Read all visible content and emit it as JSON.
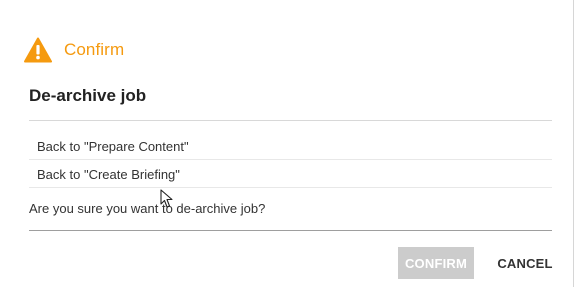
{
  "dialog": {
    "header_title": "Confirm",
    "header_icon": "warning-icon",
    "accent_color": "#f59a0f",
    "job_title": "De-archive job",
    "options": [
      {
        "label": "Back to \"Prepare Content\""
      },
      {
        "label": "Back to \"Create Briefing\""
      }
    ],
    "question": "Are you sure you want to de-archive job?",
    "buttons": {
      "confirm_label": "CONFIRM",
      "cancel_label": "CANCEL"
    }
  }
}
